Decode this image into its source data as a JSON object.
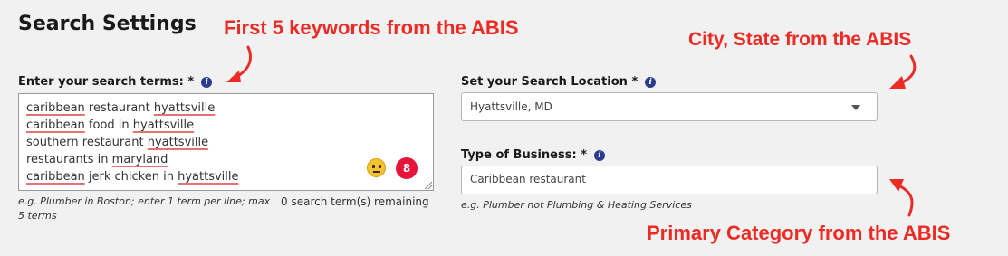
{
  "section": {
    "title": "Search Settings"
  },
  "search_terms": {
    "label": "Enter your search terms: *",
    "info_icon": "info-icon",
    "lines": [
      {
        "prefix": "",
        "w1": "caribbean",
        "mid": " restaurant ",
        "w2": "hyattsville",
        "suffix": ""
      },
      {
        "prefix": "",
        "w1": "caribbean",
        "mid": " food in ",
        "w2": "hyattsville",
        "suffix": ""
      },
      {
        "prefix": "southern restaurant ",
        "w1": "",
        "mid": "",
        "w2": "hyattsville",
        "suffix": ""
      },
      {
        "prefix": "restaurants in ",
        "w1": "",
        "mid": "",
        "w2": "maryland",
        "suffix": ""
      },
      {
        "prefix": "",
        "w1": "caribbean",
        "mid": " jerk chicken in ",
        "w2": "hyattsville",
        "suffix": ""
      }
    ],
    "emoji_icon": "neutral-face-icon",
    "badge_count": "8",
    "helper_line1": "e.g. Plumber in Boston; enter 1 term per line; max",
    "helper_line2": "5 terms",
    "remaining": "0 search term(s) remaining"
  },
  "location": {
    "label": "Set your Search Location *",
    "info_icon": "info-icon",
    "value": "Hyattsville, MD"
  },
  "business_type": {
    "label": "Type of Business: *",
    "info_icon": "info-icon",
    "value": "Caribbean restaurant",
    "helper": "e.g. Plumber not Plumbing & Heating Services"
  },
  "annotations": {
    "keywords": "First 5 keywords from the ABIS",
    "city_state": "City, State from the ABIS",
    "category": "Primary Category from the ABIS",
    "color": "#ec2b24"
  },
  "colors": {
    "background": "#f1f1f1",
    "info_icon": "#2b3c8f",
    "badge": "#e8153a",
    "spell_underline": "#e57373"
  }
}
